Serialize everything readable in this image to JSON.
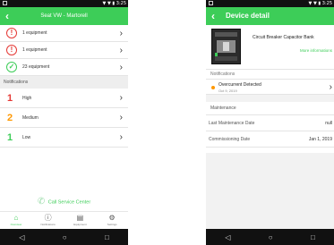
{
  "left": {
    "status_time": "3:25",
    "status_icons": "▼ ▼ ▮",
    "header": {
      "back_glyph": "‹",
      "title": "Seat VW - Martorell"
    },
    "equipment_rows": [
      {
        "icon": "alert-circle-icon",
        "glyph": "!",
        "label": "1 equipment"
      },
      {
        "icon": "alert-circle-icon",
        "glyph": "!",
        "label": "1 equipment"
      },
      {
        "icon": "check-circle-icon",
        "glyph": "✓",
        "label": "23 equipment"
      }
    ],
    "notifications_title": "Notifications",
    "notification_rows": [
      {
        "count": "1",
        "label": "High",
        "color": "#e53935"
      },
      {
        "count": "2",
        "label": "Medium",
        "color": "#ff9800"
      },
      {
        "count": "1",
        "label": "Low",
        "color": "#3dcd58"
      }
    ],
    "call_service": "Call Service Center",
    "bottom_nav": [
      {
        "icon": "home-icon",
        "glyph": "⌂",
        "label": "Overview"
      },
      {
        "icon": "notification-icon",
        "glyph": "ⓘ",
        "label": "Notifications"
      },
      {
        "icon": "equipment-icon",
        "glyph": "▤",
        "label": "Equipment"
      },
      {
        "icon": "settings-icon",
        "glyph": "⚙",
        "label": "Settings"
      }
    ],
    "chevron": "›"
  },
  "right": {
    "status_time": "3:25",
    "status_icons": "▼ ▼ ▮",
    "header": {
      "back_glyph": "‹",
      "title": "Device detail"
    },
    "device_name": "Circuit Breaker Capacitor Bank",
    "more_info": "More informations",
    "notifications_title": "Notifications",
    "alert": {
      "title": "Overcurrent Detected",
      "date": "Oct 9, 2019"
    },
    "maintenance_title": "Maintenance",
    "last_maintenance": {
      "label": "Last Maintenance Date",
      "value": "null"
    },
    "commissioning": {
      "label": "Commissioning Date",
      "value": "Jan 1, 2019"
    },
    "chevron": "›"
  },
  "system_nav": {
    "back": "◁",
    "home": "○",
    "recent": "□"
  },
  "colors": {
    "accent": "#3dcd58",
    "high": "#e53935",
    "medium": "#ff9800",
    "low": "#3dcd58"
  }
}
